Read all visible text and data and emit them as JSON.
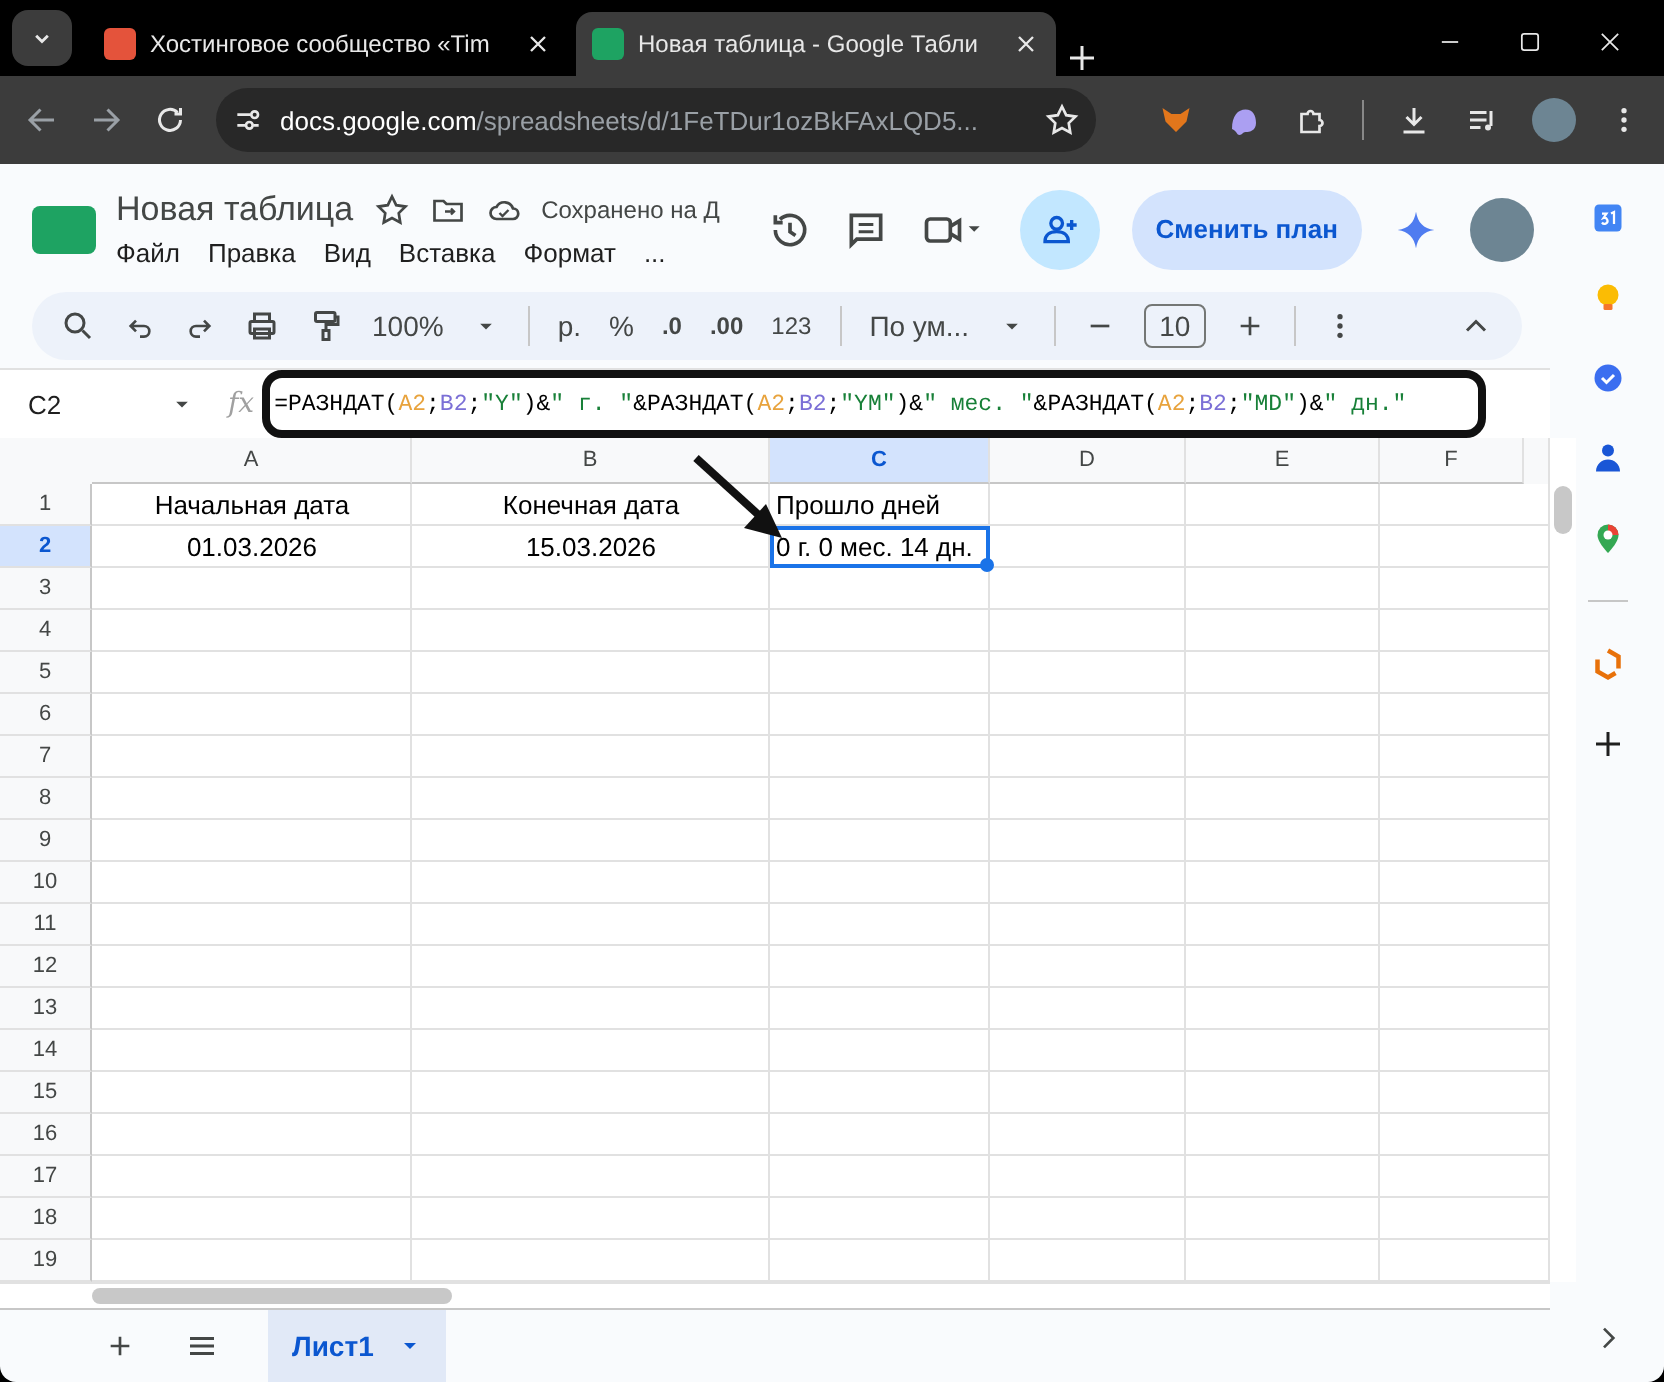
{
  "browser": {
    "tabs": [
      {
        "title": "Хостинговое сообщество «Tim",
        "selected": false,
        "kind": "red"
      },
      {
        "title": "Новая таблица - Google Табли",
        "selected": true,
        "kind": "sheets"
      }
    ],
    "url": {
      "domain": "docs.google.com",
      "path": "/spreadsheets/d/1FeTDur1ozBkFAxLQD5..."
    }
  },
  "doc": {
    "title": "Новая таблица",
    "save_status": "Сохранено на Д",
    "menu": [
      "Файл",
      "Правка",
      "Вид",
      "Вставка",
      "Формат",
      "..."
    ],
    "upgrade_button": "Сменить план"
  },
  "toolbar": {
    "zoom": "100%",
    "currency": "р.",
    "percent": "%",
    "decrease_decimals": ".0",
    "increase_decimals": ".00",
    "number_format": "123",
    "font": "По ум...",
    "font_size": "10"
  },
  "formula_bar": {
    "cell_ref": "C2",
    "fx": "fx",
    "formula": [
      {
        "kind": "plain",
        "text": "=РАЗНДАТ("
      },
      {
        "kind": "ref",
        "text": "A2",
        "color": "#e8a33d"
      },
      {
        "kind": "plain",
        "text": ";"
      },
      {
        "kind": "ref",
        "text": "B2",
        "color": "#7b6fd6"
      },
      {
        "kind": "plain",
        "text": ";"
      },
      {
        "kind": "string",
        "text": "\"Y\""
      },
      {
        "kind": "plain",
        "text": ")&"
      },
      {
        "kind": "string",
        "text": "\" г. \""
      },
      {
        "kind": "plain",
        "text": "&РАЗНДАТ("
      },
      {
        "kind": "ref",
        "text": "A2",
        "color": "#e8a33d"
      },
      {
        "kind": "plain",
        "text": ";"
      },
      {
        "kind": "ref",
        "text": "B2",
        "color": "#7b6fd6"
      },
      {
        "kind": "plain",
        "text": ";"
      },
      {
        "kind": "string",
        "text": "\"YM\""
      },
      {
        "kind": "plain",
        "text": ")&"
      },
      {
        "kind": "string",
        "text": "\" мес. \""
      },
      {
        "kind": "plain",
        "text": "&РАЗНДАТ("
      },
      {
        "kind": "ref",
        "text": "A2",
        "color": "#e8a33d"
      },
      {
        "kind": "plain",
        "text": ";"
      },
      {
        "kind": "ref",
        "text": "B2",
        "color": "#7b6fd6"
      },
      {
        "kind": "plain",
        "text": ";"
      },
      {
        "kind": "string",
        "text": "\"MD\""
      },
      {
        "kind": "plain",
        "text": ")&"
      },
      {
        "kind": "string",
        "text": "\" дн.\""
      }
    ]
  },
  "grid": {
    "columns": [
      {
        "label": "A",
        "selected": false
      },
      {
        "label": "B",
        "selected": false
      },
      {
        "label": "C",
        "selected": true
      },
      {
        "label": "D",
        "selected": false
      },
      {
        "label": "E",
        "selected": false
      },
      {
        "label": "F",
        "selected": false
      }
    ],
    "rows": [
      {
        "number": "1",
        "selected": false,
        "cells": [
          {
            "text": "Начальная дата",
            "selected": false
          },
          {
            "text": "Конечная дата",
            "selected": false
          },
          {
            "text": "Прошло дней",
            "selected": false
          }
        ]
      },
      {
        "number": "2",
        "selected": true,
        "cells": [
          {
            "text": "01.03.2026",
            "selected": false
          },
          {
            "text": "15.03.2026",
            "selected": false
          },
          {
            "text": "0 г. 0 мес. 14 дн.",
            "selected": true
          }
        ]
      },
      {
        "number": "3",
        "selected": false
      },
      {
        "number": "4",
        "selected": false
      },
      {
        "number": "5",
        "selected": false
      },
      {
        "number": "6",
        "selected": false
      },
      {
        "number": "7",
        "selected": false
      },
      {
        "number": "8",
        "selected": false
      },
      {
        "number": "9",
        "selected": false
      },
      {
        "number": "10",
        "selected": false
      },
      {
        "number": "11",
        "selected": false
      },
      {
        "number": "12",
        "selected": false
      },
      {
        "number": "13",
        "selected": false
      },
      {
        "number": "14",
        "selected": false
      },
      {
        "number": "15",
        "selected": false
      },
      {
        "number": "16",
        "selected": false
      },
      {
        "number": "17",
        "selected": false
      },
      {
        "number": "18",
        "selected": false
      },
      {
        "number": "19",
        "selected": false
      }
    ]
  },
  "sheets": [
    {
      "name": "Лист1",
      "selected": true
    }
  ]
}
